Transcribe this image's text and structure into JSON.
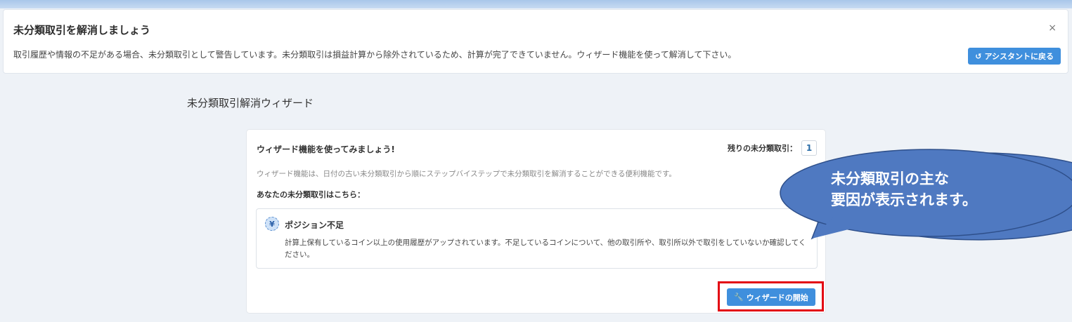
{
  "banner": {
    "title": "未分類取引を解消しましょう",
    "text": "取引履歴や情報の不足がある場合、未分類取引として警告しています。未分類取引は損益計算から除外されているため、計算が完了できていません。ウィザード機能を使って解消して下さい。",
    "close_label": "×",
    "back_button_label": "アシスタントに戻る",
    "back_icon": "undo-arrow-icon"
  },
  "page_title": "未分類取引解消ウィザード",
  "card": {
    "title": "ウィザード機能を使ってみましょう!",
    "remaining_label": "残りの未分類取引：",
    "remaining_count": "1",
    "description": "ウィザード機能は、日付の古い未分類取引から順にステップバイステップで未分類取引を解消することができる便利機能です。",
    "sub_heading": "あなたの未分類取引はこちら：",
    "issue": {
      "icon": "yen-coin-icon",
      "icon_glyph": "¥",
      "title": "ポジション不足",
      "description": "計算上保有しているコイン以上の使用履歴がアップされています。不足しているコインについて、他の取引所や、取引所以外で取引をしていないか確認してください。"
    },
    "start_button_label": "ウィザードの開始",
    "start_icon": "wrench-icon"
  },
  "callout": {
    "line1": "未分類取引の主な",
    "line2": "要因が表示されます。"
  },
  "colors": {
    "accent": "#3f8fdd",
    "callout_fill": "#4f79c1",
    "highlight": "#e30613"
  }
}
